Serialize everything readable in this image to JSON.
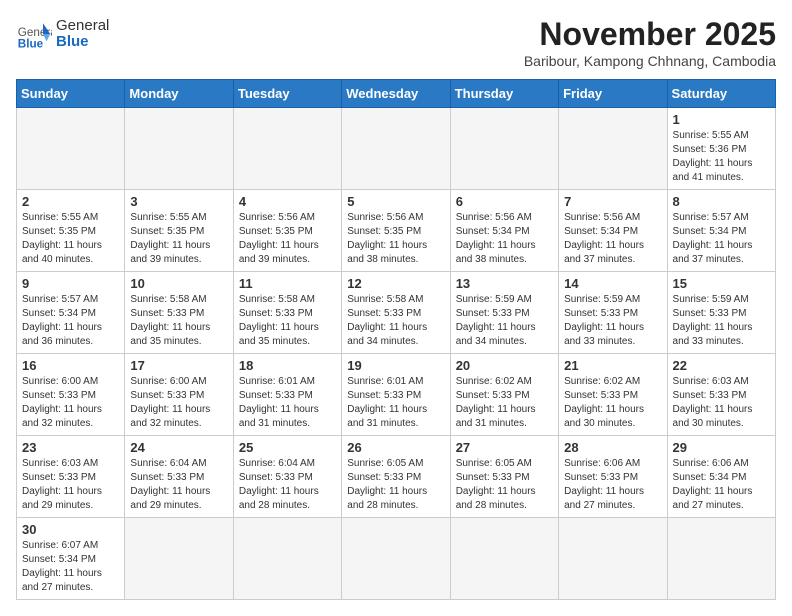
{
  "header": {
    "logo_general": "General",
    "logo_blue": "Blue",
    "month_title": "November 2025",
    "subtitle": "Baribour, Kampong Chhnang, Cambodia"
  },
  "weekdays": [
    "Sunday",
    "Monday",
    "Tuesday",
    "Wednesday",
    "Thursday",
    "Friday",
    "Saturday"
  ],
  "weeks": [
    [
      {
        "day": null
      },
      {
        "day": null
      },
      {
        "day": null
      },
      {
        "day": null
      },
      {
        "day": null
      },
      {
        "day": null
      },
      {
        "day": "1",
        "sunrise": "5:55 AM",
        "sunset": "5:36 PM",
        "daylight": "11 hours and 41 minutes."
      }
    ],
    [
      {
        "day": "2",
        "sunrise": "5:55 AM",
        "sunset": "5:35 PM",
        "daylight": "11 hours and 40 minutes."
      },
      {
        "day": "3",
        "sunrise": "5:55 AM",
        "sunset": "5:35 PM",
        "daylight": "11 hours and 39 minutes."
      },
      {
        "day": "4",
        "sunrise": "5:56 AM",
        "sunset": "5:35 PM",
        "daylight": "11 hours and 39 minutes."
      },
      {
        "day": "5",
        "sunrise": "5:56 AM",
        "sunset": "5:35 PM",
        "daylight": "11 hours and 38 minutes."
      },
      {
        "day": "6",
        "sunrise": "5:56 AM",
        "sunset": "5:34 PM",
        "daylight": "11 hours and 38 minutes."
      },
      {
        "day": "7",
        "sunrise": "5:56 AM",
        "sunset": "5:34 PM",
        "daylight": "11 hours and 37 minutes."
      },
      {
        "day": "8",
        "sunrise": "5:57 AM",
        "sunset": "5:34 PM",
        "daylight": "11 hours and 37 minutes."
      }
    ],
    [
      {
        "day": "9",
        "sunrise": "5:57 AM",
        "sunset": "5:34 PM",
        "daylight": "11 hours and 36 minutes."
      },
      {
        "day": "10",
        "sunrise": "5:58 AM",
        "sunset": "5:33 PM",
        "daylight": "11 hours and 35 minutes."
      },
      {
        "day": "11",
        "sunrise": "5:58 AM",
        "sunset": "5:33 PM",
        "daylight": "11 hours and 35 minutes."
      },
      {
        "day": "12",
        "sunrise": "5:58 AM",
        "sunset": "5:33 PM",
        "daylight": "11 hours and 34 minutes."
      },
      {
        "day": "13",
        "sunrise": "5:59 AM",
        "sunset": "5:33 PM",
        "daylight": "11 hours and 34 minutes."
      },
      {
        "day": "14",
        "sunrise": "5:59 AM",
        "sunset": "5:33 PM",
        "daylight": "11 hours and 33 minutes."
      },
      {
        "day": "15",
        "sunrise": "5:59 AM",
        "sunset": "5:33 PM",
        "daylight": "11 hours and 33 minutes."
      }
    ],
    [
      {
        "day": "16",
        "sunrise": "6:00 AM",
        "sunset": "5:33 PM",
        "daylight": "11 hours and 32 minutes."
      },
      {
        "day": "17",
        "sunrise": "6:00 AM",
        "sunset": "5:33 PM",
        "daylight": "11 hours and 32 minutes."
      },
      {
        "day": "18",
        "sunrise": "6:01 AM",
        "sunset": "5:33 PM",
        "daylight": "11 hours and 31 minutes."
      },
      {
        "day": "19",
        "sunrise": "6:01 AM",
        "sunset": "5:33 PM",
        "daylight": "11 hours and 31 minutes."
      },
      {
        "day": "20",
        "sunrise": "6:02 AM",
        "sunset": "5:33 PM",
        "daylight": "11 hours and 31 minutes."
      },
      {
        "day": "21",
        "sunrise": "6:02 AM",
        "sunset": "5:33 PM",
        "daylight": "11 hours and 30 minutes."
      },
      {
        "day": "22",
        "sunrise": "6:03 AM",
        "sunset": "5:33 PM",
        "daylight": "11 hours and 30 minutes."
      }
    ],
    [
      {
        "day": "23",
        "sunrise": "6:03 AM",
        "sunset": "5:33 PM",
        "daylight": "11 hours and 29 minutes."
      },
      {
        "day": "24",
        "sunrise": "6:04 AM",
        "sunset": "5:33 PM",
        "daylight": "11 hours and 29 minutes."
      },
      {
        "day": "25",
        "sunrise": "6:04 AM",
        "sunset": "5:33 PM",
        "daylight": "11 hours and 28 minutes."
      },
      {
        "day": "26",
        "sunrise": "6:05 AM",
        "sunset": "5:33 PM",
        "daylight": "11 hours and 28 minutes."
      },
      {
        "day": "27",
        "sunrise": "6:05 AM",
        "sunset": "5:33 PM",
        "daylight": "11 hours and 28 minutes."
      },
      {
        "day": "28",
        "sunrise": "6:06 AM",
        "sunset": "5:33 PM",
        "daylight": "11 hours and 27 minutes."
      },
      {
        "day": "29",
        "sunrise": "6:06 AM",
        "sunset": "5:34 PM",
        "daylight": "11 hours and 27 minutes."
      }
    ],
    [
      {
        "day": "30",
        "sunrise": "6:07 AM",
        "sunset": "5:34 PM",
        "daylight": "11 hours and 27 minutes."
      },
      {
        "day": null
      },
      {
        "day": null
      },
      {
        "day": null
      },
      {
        "day": null
      },
      {
        "day": null
      },
      {
        "day": null
      }
    ]
  ]
}
